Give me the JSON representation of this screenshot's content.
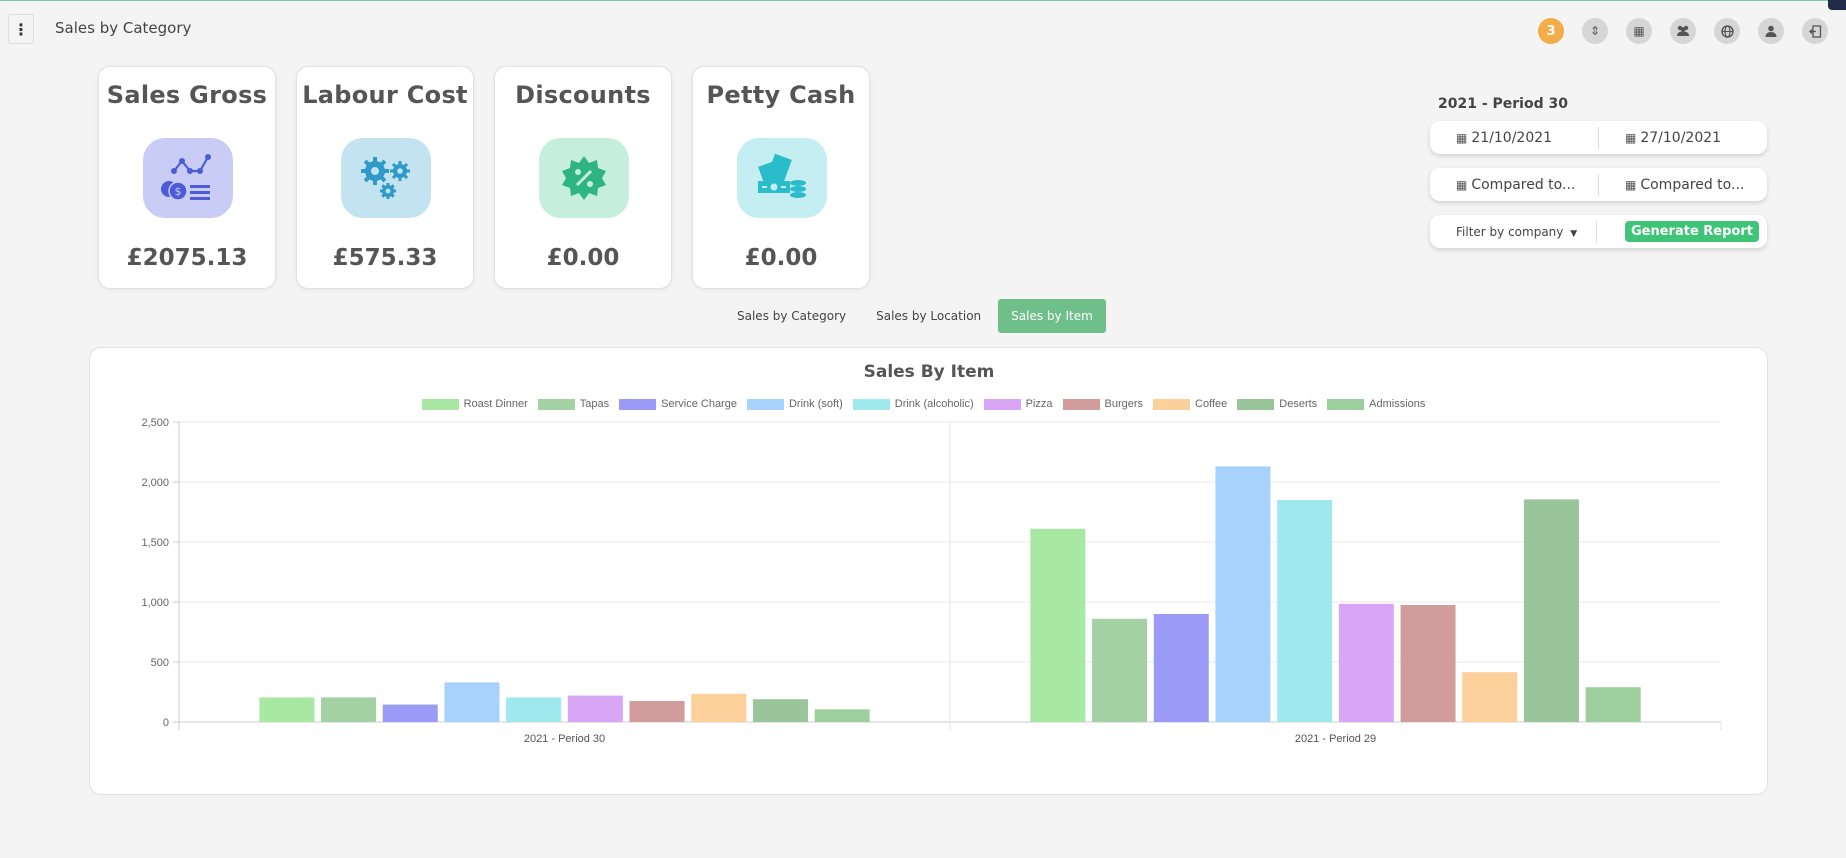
{
  "header": {
    "title": "Sales by Category",
    "menu_icon": "kebab-menu-icon",
    "icons": [
      {
        "name": "notification-badge",
        "label": "3"
      },
      {
        "name": "sort-icon",
        "label": "⇕"
      },
      {
        "name": "grid-icon",
        "label": "▦"
      },
      {
        "name": "users-icon",
        "label": "👥"
      },
      {
        "name": "globe-icon",
        "label": "◍"
      },
      {
        "name": "user-icon",
        "label": "●"
      },
      {
        "name": "logout-icon",
        "label": "⇥"
      }
    ]
  },
  "cards": [
    {
      "title": "Sales Gross",
      "value": "£2075.13",
      "icon": "sales-chart-icon",
      "bg": "#c9cdf6",
      "fg": "#4d5bd6"
    },
    {
      "title": "Labour Cost",
      "value": "£575.33",
      "icon": "gears-icon",
      "bg": "#c3e3f1",
      "fg": "#2f99c9"
    },
    {
      "title": "Discounts",
      "value": "£0.00",
      "icon": "discount-badge-icon",
      "bg": "#c6eedd",
      "fg": "#2fb486"
    },
    {
      "title": "Petty Cash",
      "value": "£0.00",
      "icon": "cash-icon",
      "bg": "#c5eef2",
      "fg": "#2bbccb"
    }
  ],
  "period": {
    "title": "2021 - Period 30",
    "date_from": "21/10/2021",
    "date_to": "27/10/2021",
    "compare_from": "Compared to...",
    "compare_to": "Compared to...",
    "filter_label": "Filter by company",
    "generate_label": "Generate Report"
  },
  "tabs": [
    {
      "label": "Sales by Category",
      "active": false
    },
    {
      "label": "Sales by Location",
      "active": false
    },
    {
      "label": "Sales by Item",
      "active": true
    }
  ],
  "chart_data": {
    "type": "bar",
    "title": "Sales By Item",
    "categories": [
      "2021 - Period 30",
      "2021 - Period 29"
    ],
    "ylim": [
      0,
      2500
    ],
    "yticks": [
      "0",
      "500",
      "1,000",
      "1,500",
      "2,000",
      "2,500"
    ],
    "grid": true,
    "legend_position": "top",
    "series": [
      {
        "name": "Roast Dinner",
        "color": "#a9e8a3",
        "values": [
          205,
          1610
        ]
      },
      {
        "name": "Tapas",
        "color": "#a4d1a3",
        "values": [
          205,
          860
        ]
      },
      {
        "name": "Service Charge",
        "color": "#9b9bf7",
        "values": [
          145,
          900
        ]
      },
      {
        "name": "Drink (soft)",
        "color": "#a6d2fc",
        "values": [
          330,
          2130
        ]
      },
      {
        "name": "Drink (alcoholic)",
        "color": "#9fe8ee",
        "values": [
          205,
          1850
        ]
      },
      {
        "name": "Pizza",
        "color": "#d9a6f5",
        "values": [
          220,
          985
        ]
      },
      {
        "name": "Burgers",
        "color": "#d29c9c",
        "values": [
          175,
          975
        ]
      },
      {
        "name": "Coffee",
        "color": "#fcd09a",
        "values": [
          235,
          415
        ]
      },
      {
        "name": "Deserts",
        "color": "#9ac49a",
        "values": [
          190,
          1855
        ]
      },
      {
        "name": "Admissions",
        "color": "#9dcf9e",
        "values": [
          105,
          290
        ]
      }
    ]
  }
}
